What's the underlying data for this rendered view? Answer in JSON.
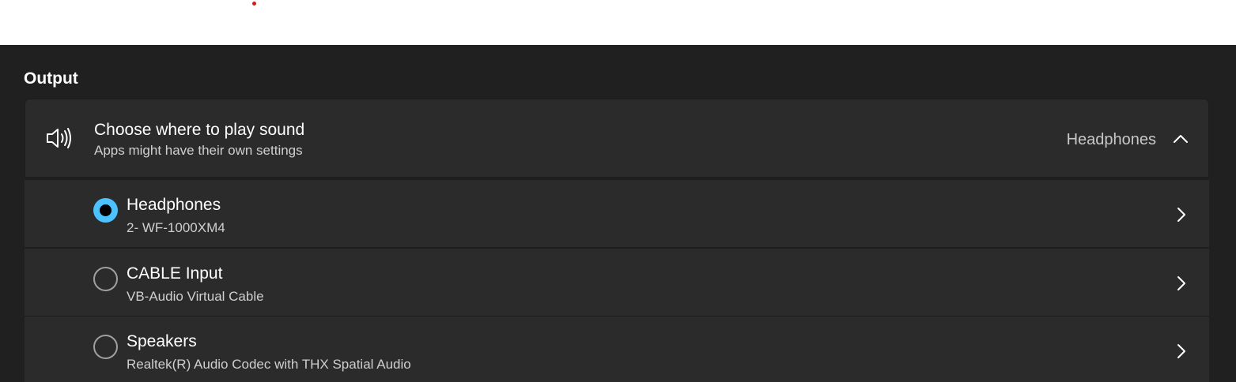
{
  "section": {
    "title": "Output"
  },
  "output_card": {
    "title": "Choose where to play sound",
    "subtitle": "Apps might have their own settings",
    "selected_device": "Headphones",
    "expanded": true
  },
  "devices": [
    {
      "name": "Headphones",
      "description": "2- WF-1000XM4",
      "selected": true
    },
    {
      "name": "CABLE Input",
      "description": "VB-Audio Virtual Cable",
      "selected": false
    },
    {
      "name": "Speakers",
      "description": "Realtek(R) Audio Codec with THX Spatial Audio",
      "selected": false
    }
  ],
  "colors": {
    "accent": "#4cc2ff",
    "background": "#202020",
    "card": "#2b2b2b"
  },
  "icons": {
    "speaker": "speaker-volume-icon",
    "collapse": "chevron-up-icon",
    "open": "chevron-right-icon"
  }
}
